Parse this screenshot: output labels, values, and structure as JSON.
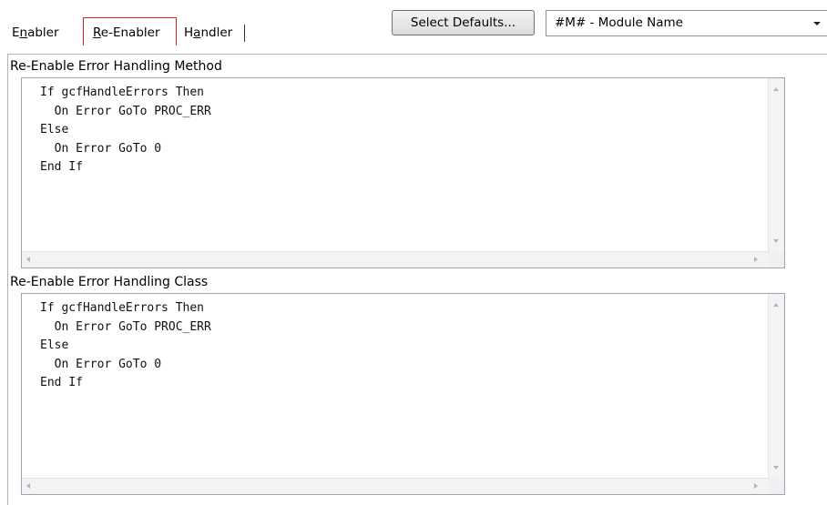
{
  "tabs": [
    {
      "mnemonic_pre": "E",
      "mnemonic": "n",
      "rest": "abler",
      "active": false
    },
    {
      "mnemonic_pre": "",
      "mnemonic": "R",
      "rest": "e-Enabler",
      "active": true
    },
    {
      "mnemonic_pre": "H",
      "mnemonic": "a",
      "rest": "ndler",
      "active": false
    }
  ],
  "toolbar": {
    "defaults_label": "Select Defaults...",
    "combo_value": "#M# - Module Name"
  },
  "sections": {
    "method": {
      "label": "Re-Enable Error Handling Method",
      "code": "If gcfHandleErrors Then\n  On Error GoTo PROC_ERR\nElse\n  On Error GoTo 0\nEnd If"
    },
    "class": {
      "label": "Re-Enable Error Handling Class",
      "code": "If gcfHandleErrors Then\n  On Error GoTo PROC_ERR\nElse\n  On Error GoTo 0\nEnd If"
    }
  },
  "colors": {
    "active_tab_border": "#d21d2b",
    "editor_border": "#9aa6b7"
  }
}
